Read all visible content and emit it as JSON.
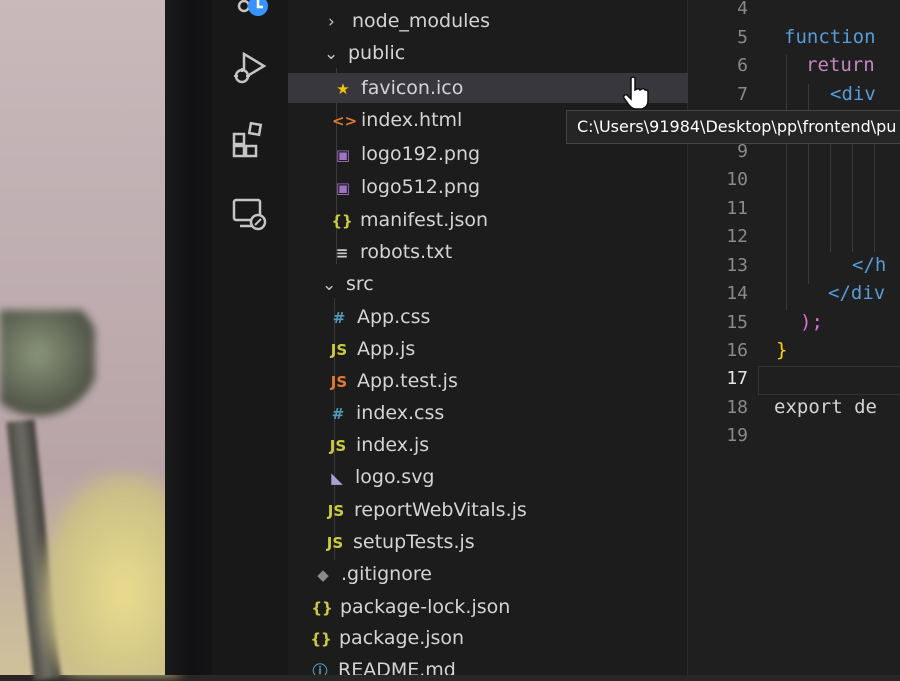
{
  "explorer": {
    "items": [
      {
        "label": "node_modules",
        "type": "folder",
        "collapsed": true,
        "icon": "chevron-right"
      },
      {
        "label": "public",
        "type": "folder",
        "collapsed": false,
        "icon": "chevron-down"
      },
      {
        "label": "favicon.ico",
        "type": "file",
        "icon": "star",
        "icon_color": "#f1c40f"
      },
      {
        "label": "index.html",
        "type": "file",
        "icon": "<>",
        "icon_color": "#e37933"
      },
      {
        "label": "logo192.png",
        "type": "file",
        "icon": "image",
        "icon_color": "#a074c4"
      },
      {
        "label": "logo512.png",
        "type": "file",
        "icon": "image",
        "icon_color": "#a074c4"
      },
      {
        "label": "manifest.json",
        "type": "file",
        "icon": "{}",
        "icon_color": "#cbcb41"
      },
      {
        "label": "robots.txt",
        "type": "file",
        "icon": "lines",
        "icon_color": "#cccccc"
      },
      {
        "label": "src",
        "type": "folder",
        "collapsed": false,
        "icon": "chevron-down"
      },
      {
        "label": "App.css",
        "type": "file",
        "icon": "#",
        "icon_color": "#519aba"
      },
      {
        "label": "App.js",
        "type": "file",
        "icon": "JS",
        "icon_color": "#cbcb41"
      },
      {
        "label": "App.test.js",
        "type": "file",
        "icon": "JS",
        "icon_color": "#e37933"
      },
      {
        "label": "index.css",
        "type": "file",
        "icon": "#",
        "icon_color": "#519aba"
      },
      {
        "label": "index.js",
        "type": "file",
        "icon": "JS",
        "icon_color": "#cbcb41"
      },
      {
        "label": "logo.svg",
        "type": "file",
        "icon": "svg",
        "icon_color": "#a3a3d6"
      },
      {
        "label": "reportWebVitals.js",
        "type": "file",
        "icon": "JS",
        "icon_color": "#cbcb41"
      },
      {
        "label": "setupTests.js",
        "type": "file",
        "icon": "JS",
        "icon_color": "#cbcb41"
      },
      {
        "label": ".gitignore",
        "type": "file",
        "icon": "git",
        "icon_color": "#8a8a8a"
      },
      {
        "label": "package-lock.json",
        "type": "file",
        "icon": "{}",
        "icon_color": "#cbcb41"
      },
      {
        "label": "package.json",
        "type": "file",
        "icon": "{}",
        "icon_color": "#cbcb41"
      },
      {
        "label": "README.md",
        "type": "file",
        "icon": "info",
        "icon_color": "#519aba"
      }
    ]
  },
  "tooltip": {
    "text": "C:\\Users\\91984\\Desktop\\pp\\frontend\\pu"
  },
  "editor": {
    "line_numbers": [
      "4",
      "5",
      "6",
      "7",
      "8",
      "9",
      "10",
      "11",
      "12",
      "13",
      "14",
      "15",
      "16",
      "17",
      "18",
      "19"
    ],
    "active_line": "17",
    "lines": {
      "l5": "function",
      "l6": "return",
      "l7": "<div",
      "l13": "</h",
      "l14": "</div",
      "l15": ");",
      "l16": "}",
      "l18": "export de"
    }
  },
  "activity_icons": [
    "source-control-icon",
    "run-debug-icon",
    "extensions-icon",
    "remote-explorer-icon"
  ]
}
